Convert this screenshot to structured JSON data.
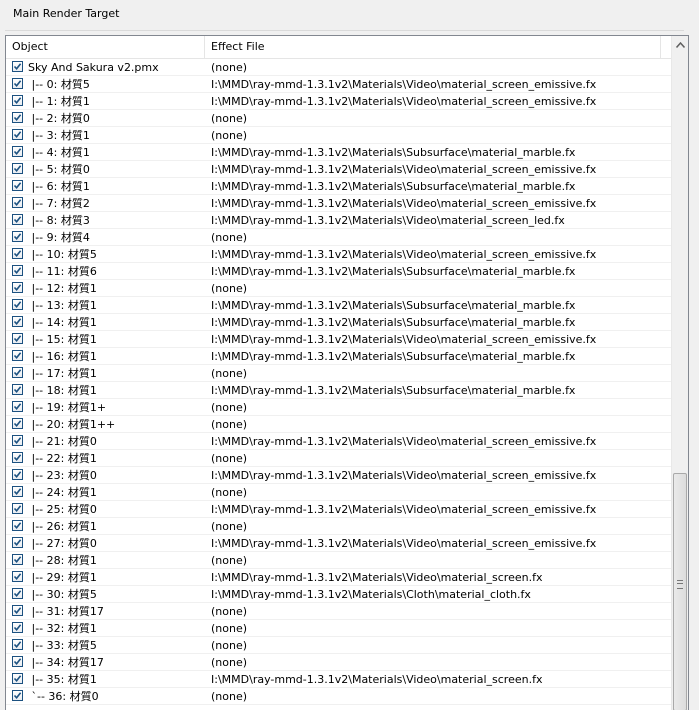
{
  "panel": {
    "title": "Main Render Target"
  },
  "columns": {
    "object": "Object",
    "effect": "Effect File"
  },
  "rows": [
    {
      "object": "Sky And Sakura v2.pmx",
      "effect": "(none)"
    },
    {
      "object": " |-- 0: 材質5",
      "effect": "I:\\MMD\\ray-mmd-1.3.1v2\\Materials\\Video\\material_screen_emissive.fx"
    },
    {
      "object": " |-- 1: 材質1",
      "effect": "I:\\MMD\\ray-mmd-1.3.1v2\\Materials\\Video\\material_screen_emissive.fx"
    },
    {
      "object": " |-- 2: 材質0",
      "effect": "(none)"
    },
    {
      "object": " |-- 3: 材質1",
      "effect": "(none)"
    },
    {
      "object": " |-- 4: 材質1",
      "effect": "I:\\MMD\\ray-mmd-1.3.1v2\\Materials\\Subsurface\\material_marble.fx"
    },
    {
      "object": " |-- 5: 材質0",
      "effect": "I:\\MMD\\ray-mmd-1.3.1v2\\Materials\\Video\\material_screen_emissive.fx"
    },
    {
      "object": " |-- 6: 材質1",
      "effect": "I:\\MMD\\ray-mmd-1.3.1v2\\Materials\\Subsurface\\material_marble.fx"
    },
    {
      "object": " |-- 7: 材質2",
      "effect": "I:\\MMD\\ray-mmd-1.3.1v2\\Materials\\Video\\material_screen_emissive.fx"
    },
    {
      "object": " |-- 8: 材質3",
      "effect": "I:\\MMD\\ray-mmd-1.3.1v2\\Materials\\Video\\material_screen_led.fx"
    },
    {
      "object": " |-- 9: 材質4",
      "effect": "(none)"
    },
    {
      "object": " |-- 10: 材質5",
      "effect": "I:\\MMD\\ray-mmd-1.3.1v2\\Materials\\Video\\material_screen_emissive.fx"
    },
    {
      "object": " |-- 11: 材質6",
      "effect": "I:\\MMD\\ray-mmd-1.3.1v2\\Materials\\Subsurface\\material_marble.fx"
    },
    {
      "object": " |-- 12: 材質1",
      "effect": "(none)"
    },
    {
      "object": " |-- 13: 材質1",
      "effect": "I:\\MMD\\ray-mmd-1.3.1v2\\Materials\\Subsurface\\material_marble.fx"
    },
    {
      "object": " |-- 14: 材質1",
      "effect": "I:\\MMD\\ray-mmd-1.3.1v2\\Materials\\Subsurface\\material_marble.fx"
    },
    {
      "object": " |-- 15: 材質1",
      "effect": "I:\\MMD\\ray-mmd-1.3.1v2\\Materials\\Video\\material_screen_emissive.fx"
    },
    {
      "object": " |-- 16: 材質1",
      "effect": "I:\\MMD\\ray-mmd-1.3.1v2\\Materials\\Subsurface\\material_marble.fx"
    },
    {
      "object": " |-- 17: 材質1",
      "effect": "(none)"
    },
    {
      "object": " |-- 18: 材質1",
      "effect": "I:\\MMD\\ray-mmd-1.3.1v2\\Materials\\Subsurface\\material_marble.fx"
    },
    {
      "object": " |-- 19: 材質1+",
      "effect": "(none)"
    },
    {
      "object": " |-- 20: 材質1++",
      "effect": "(none)"
    },
    {
      "object": " |-- 21: 材質0",
      "effect": "I:\\MMD\\ray-mmd-1.3.1v2\\Materials\\Video\\material_screen_emissive.fx"
    },
    {
      "object": " |-- 22: 材質1",
      "effect": "(none)"
    },
    {
      "object": " |-- 23: 材質0",
      "effect": "I:\\MMD\\ray-mmd-1.3.1v2\\Materials\\Video\\material_screen_emissive.fx"
    },
    {
      "object": " |-- 24: 材質1",
      "effect": "(none)"
    },
    {
      "object": " |-- 25: 材質0",
      "effect": "I:\\MMD\\ray-mmd-1.3.1v2\\Materials\\Video\\material_screen_emissive.fx"
    },
    {
      "object": " |-- 26: 材質1",
      "effect": "(none)"
    },
    {
      "object": " |-- 27: 材質0",
      "effect": "I:\\MMD\\ray-mmd-1.3.1v2\\Materials\\Video\\material_screen_emissive.fx"
    },
    {
      "object": " |-- 28: 材質1",
      "effect": "(none)"
    },
    {
      "object": " |-- 29: 材質1",
      "effect": "I:\\MMD\\ray-mmd-1.3.1v2\\Materials\\Video\\material_screen.fx"
    },
    {
      "object": " |-- 30: 材質5",
      "effect": "I:\\MMD\\ray-mmd-1.3.1v2\\Materials\\Cloth\\material_cloth.fx"
    },
    {
      "object": " |-- 31: 材質17",
      "effect": "(none)"
    },
    {
      "object": " |-- 32: 材質1",
      "effect": "(none)"
    },
    {
      "object": " |-- 33: 材質5",
      "effect": "(none)"
    },
    {
      "object": " |-- 34: 材質17",
      "effect": "(none)"
    },
    {
      "object": " |-- 35: 材質1",
      "effect": "I:\\MMD\\ray-mmd-1.3.1v2\\Materials\\Video\\material_screen.fx"
    },
    {
      "object": " `-- 36: 材質0",
      "effect": "(none)"
    }
  ],
  "icons": {
    "checkbox": "checkmark-icon",
    "scroll_up": "arrow-up-icon",
    "thumb": "grip-icon"
  },
  "colors": {
    "check": "#1c5180",
    "border": "#828790"
  }
}
